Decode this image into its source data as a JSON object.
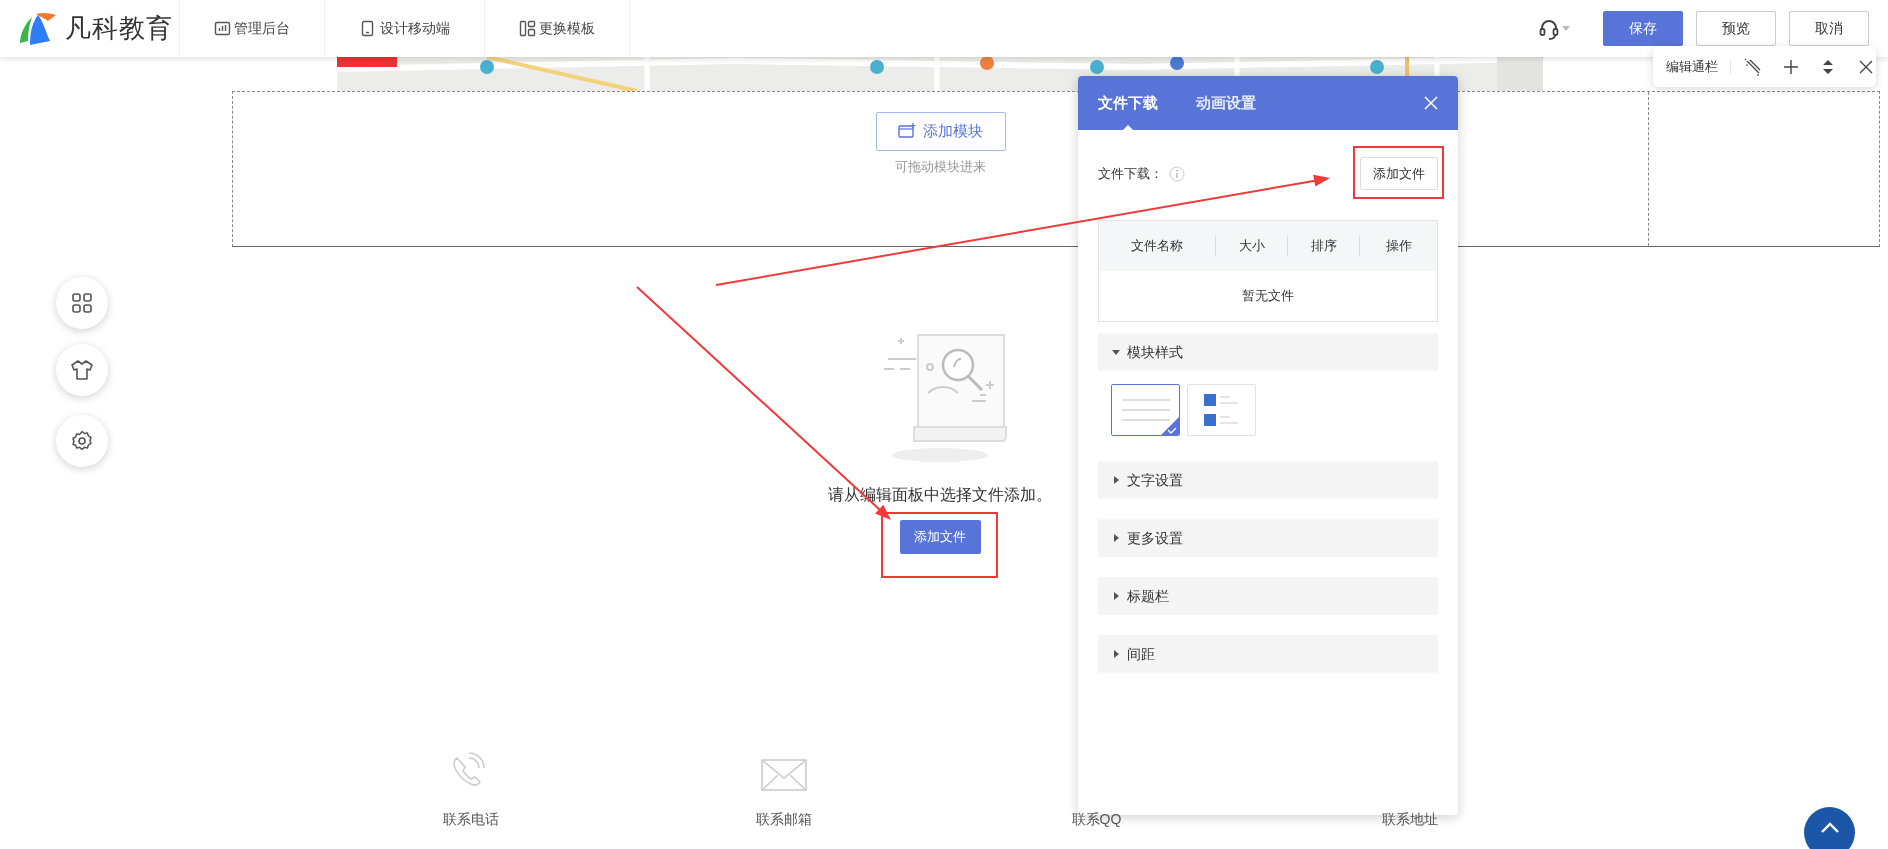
{
  "header": {
    "logo": "凡科教育",
    "nav": [
      {
        "label": "管理后台"
      },
      {
        "label": "设计移动端"
      },
      {
        "label": "更换模板"
      }
    ],
    "buttons": [
      {
        "label": "保存",
        "kind": "primary"
      },
      {
        "label": "预览",
        "kind": "outline"
      },
      {
        "label": "取消",
        "kind": "outline"
      }
    ]
  },
  "edit_toolbar": {
    "label": "编辑通栏"
  },
  "module_area": {
    "button": "添加模块",
    "hint": "可拖动模块进来"
  },
  "empty_state": {
    "message": "请从编辑面板中选择文件添加。",
    "button": "添加文件"
  },
  "contacts": [
    {
      "label": "联系电话"
    },
    {
      "label": "联系邮箱"
    },
    {
      "label": "联系QQ"
    },
    {
      "label": "联系地址"
    }
  ],
  "panel": {
    "tabs": [
      {
        "label": "文件下载",
        "selected": true
      },
      {
        "label": "动画设置",
        "selected": false
      }
    ],
    "file_label": "文件下载：",
    "add_button": "添加文件",
    "table": {
      "columns": [
        "文件名称",
        "大小",
        "排序",
        "操作"
      ],
      "empty": "暂无文件"
    },
    "sections": [
      {
        "title": "模块样式",
        "expanded": true
      },
      {
        "title": "文字设置",
        "expanded": false
      },
      {
        "title": "更多设置",
        "expanded": false
      },
      {
        "title": "标题栏",
        "expanded": false
      },
      {
        "title": "间距",
        "expanded": false
      }
    ],
    "styles": [
      {
        "kind": "text-list",
        "selected": true
      },
      {
        "kind": "icon-list",
        "selected": false
      }
    ]
  }
}
